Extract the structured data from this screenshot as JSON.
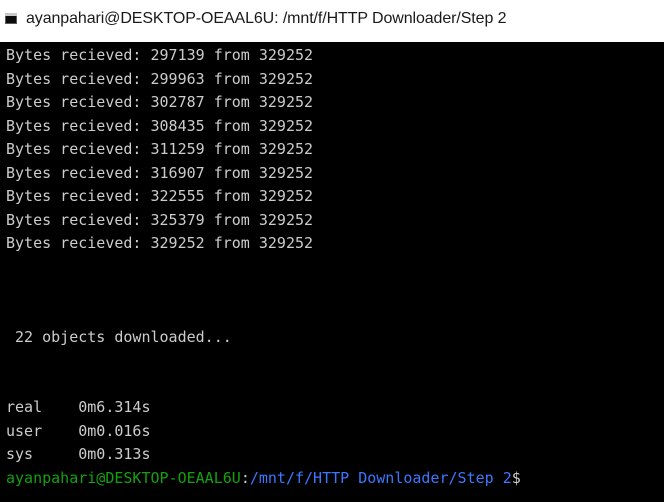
{
  "window": {
    "title": "ayanpahari@DESKTOP-OEAAL6U: /mnt/f/HTTP Downloader/Step 2",
    "icon": "terminal-icon"
  },
  "terminal": {
    "progress_lines": [
      "Bytes recieved: 297139 from 329252",
      "Bytes recieved: 299963 from 329252",
      "Bytes recieved: 302787 from 329252",
      "Bytes recieved: 308435 from 329252",
      "Bytes recieved: 311259 from 329252",
      "Bytes recieved: 316907 from 329252",
      "Bytes recieved: 322555 from 329252",
      "Bytes recieved: 325379 from 329252",
      "Bytes recieved: 329252 from 329252"
    ],
    "summary_line": " 22 objects downloaded...",
    "timing": {
      "real": "real\t0m6.314s",
      "user": "user\t0m0.016s",
      "sys": "sys\t0m0.313s"
    },
    "prompt": {
      "user_host": "ayanpahari@DESKTOP-OEAAL6U",
      "separator": ":",
      "path": "/mnt/f/HTTP Downloader/Step 2",
      "symbol": "$"
    }
  },
  "colors": {
    "background": "#000000",
    "foreground": "#cccccc",
    "prompt_user": "#13a10e",
    "prompt_path": "#3b78ff"
  }
}
